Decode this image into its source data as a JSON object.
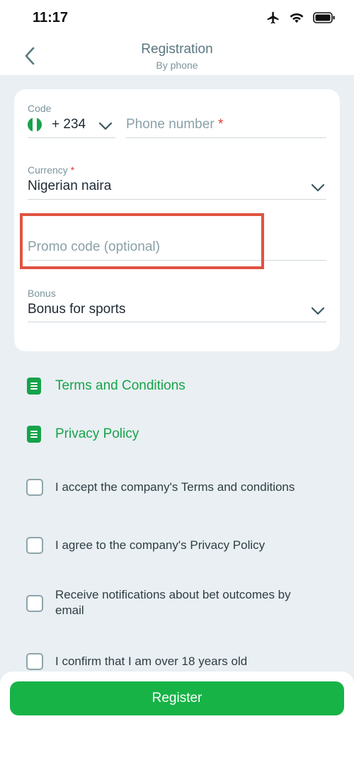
{
  "status_bar": {
    "time": "11:17",
    "icons": [
      "airplane-icon",
      "wifi-icon",
      "battery-icon"
    ]
  },
  "header": {
    "title": "Registration",
    "subtitle": "By phone"
  },
  "form": {
    "code": {
      "label": "Code",
      "value": "+ 234"
    },
    "phone": {
      "placeholder": "Phone number",
      "required_mark": "*"
    },
    "currency": {
      "label": "Currency",
      "required_mark": "*",
      "value": "Nigerian naira"
    },
    "promo": {
      "placeholder": "Promo code (optional)"
    },
    "bonus": {
      "label": "Bonus",
      "value": "Bonus for sports"
    }
  },
  "links": [
    {
      "label": "Terms and Conditions"
    },
    {
      "label": "Privacy Policy"
    }
  ],
  "checkboxes": [
    {
      "label": "I accept the company's Terms and conditions",
      "checked": false
    },
    {
      "label": "I agree to the company's Privacy Policy",
      "checked": false
    },
    {
      "label": "Receive notifications about bet outcomes by email",
      "checked": false
    },
    {
      "label": "I confirm that I am over 18 years old",
      "checked": false
    }
  ],
  "register_button": {
    "label": "Register"
  },
  "colors": {
    "accent_green": "#17b347",
    "highlight_red": "#e05342",
    "background": "#e9eff2"
  }
}
